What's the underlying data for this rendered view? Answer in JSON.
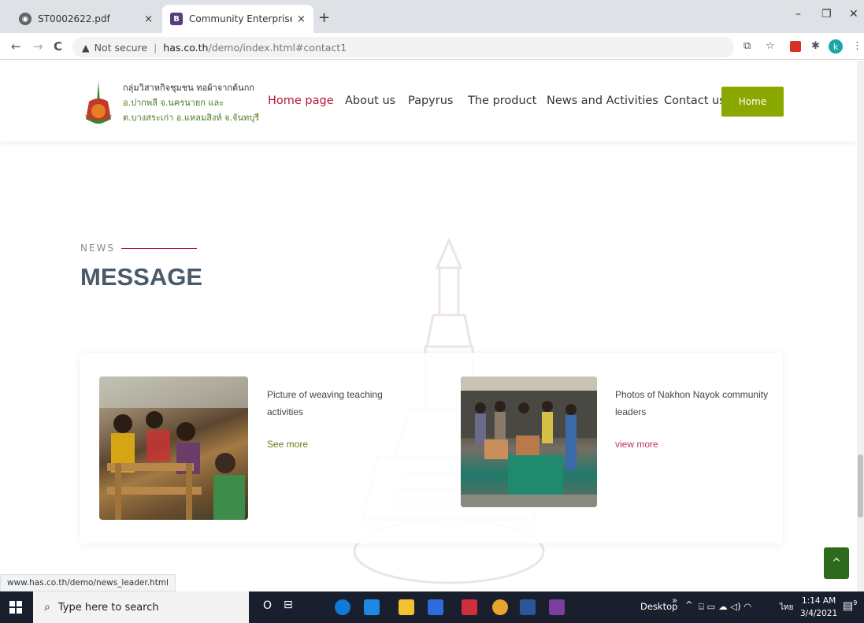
{
  "browser": {
    "tabs": [
      {
        "title": "ST0002622.pdf",
        "close": "×"
      },
      {
        "title": "Community Enterprise Group We",
        "close": "×"
      }
    ],
    "new_tab": "+",
    "window_controls": [
      "–",
      "❐",
      "✕"
    ],
    "nav": {
      "back": "←",
      "forward": "→",
      "reload": "C"
    },
    "address": {
      "warning": "▲",
      "not_secure": "Not secure",
      "separator": "|",
      "host": "has.co.th",
      "path": "/demo/index.html#contact1"
    },
    "extensions": {
      "avatar_letter": "k",
      "menu": "⋮",
      "star": "☆",
      "puzzle": "✱"
    }
  },
  "site": {
    "logo_lines": [
      "กลุ่มวิสาหกิจชุมชน ทอผ้าจากต้นกก",
      "อ.ปากพลี จ.นครนายก และ",
      "ต.บางสระเก่า อ.แหลมสิงห์ จ.จันทบุรี"
    ],
    "menu": [
      "Home page",
      "About us",
      "Papyrus",
      "The product",
      "News and Activities",
      "Contact us."
    ],
    "home_button": "Home"
  },
  "news": {
    "eyebrow": "NEWS",
    "heading": "MESSAGE",
    "items": [
      {
        "title_line1": "Picture of weaving teaching",
        "title_line2": "activities",
        "link": "See more"
      },
      {
        "title_line1": "Photos of Nakhon Nayok community",
        "title_line2": "leaders",
        "link": "view more"
      }
    ]
  },
  "to_top": "^",
  "status_url": "www.has.co.th/demo/news_leader.html",
  "taskbar": {
    "search_placeholder": "Type here to search",
    "cortana": "O",
    "task_view": "⊟",
    "desktop_label": "Desktop",
    "chevron": "»",
    "tray_up": "^",
    "lang": "ไทย",
    "time": "1:14 AM",
    "date": "3/4/2021",
    "notification_count": "9"
  },
  "colors": {
    "accent_red": "#b5163a",
    "home_button": "#8aa800",
    "to_top": "#2e6a1c"
  }
}
